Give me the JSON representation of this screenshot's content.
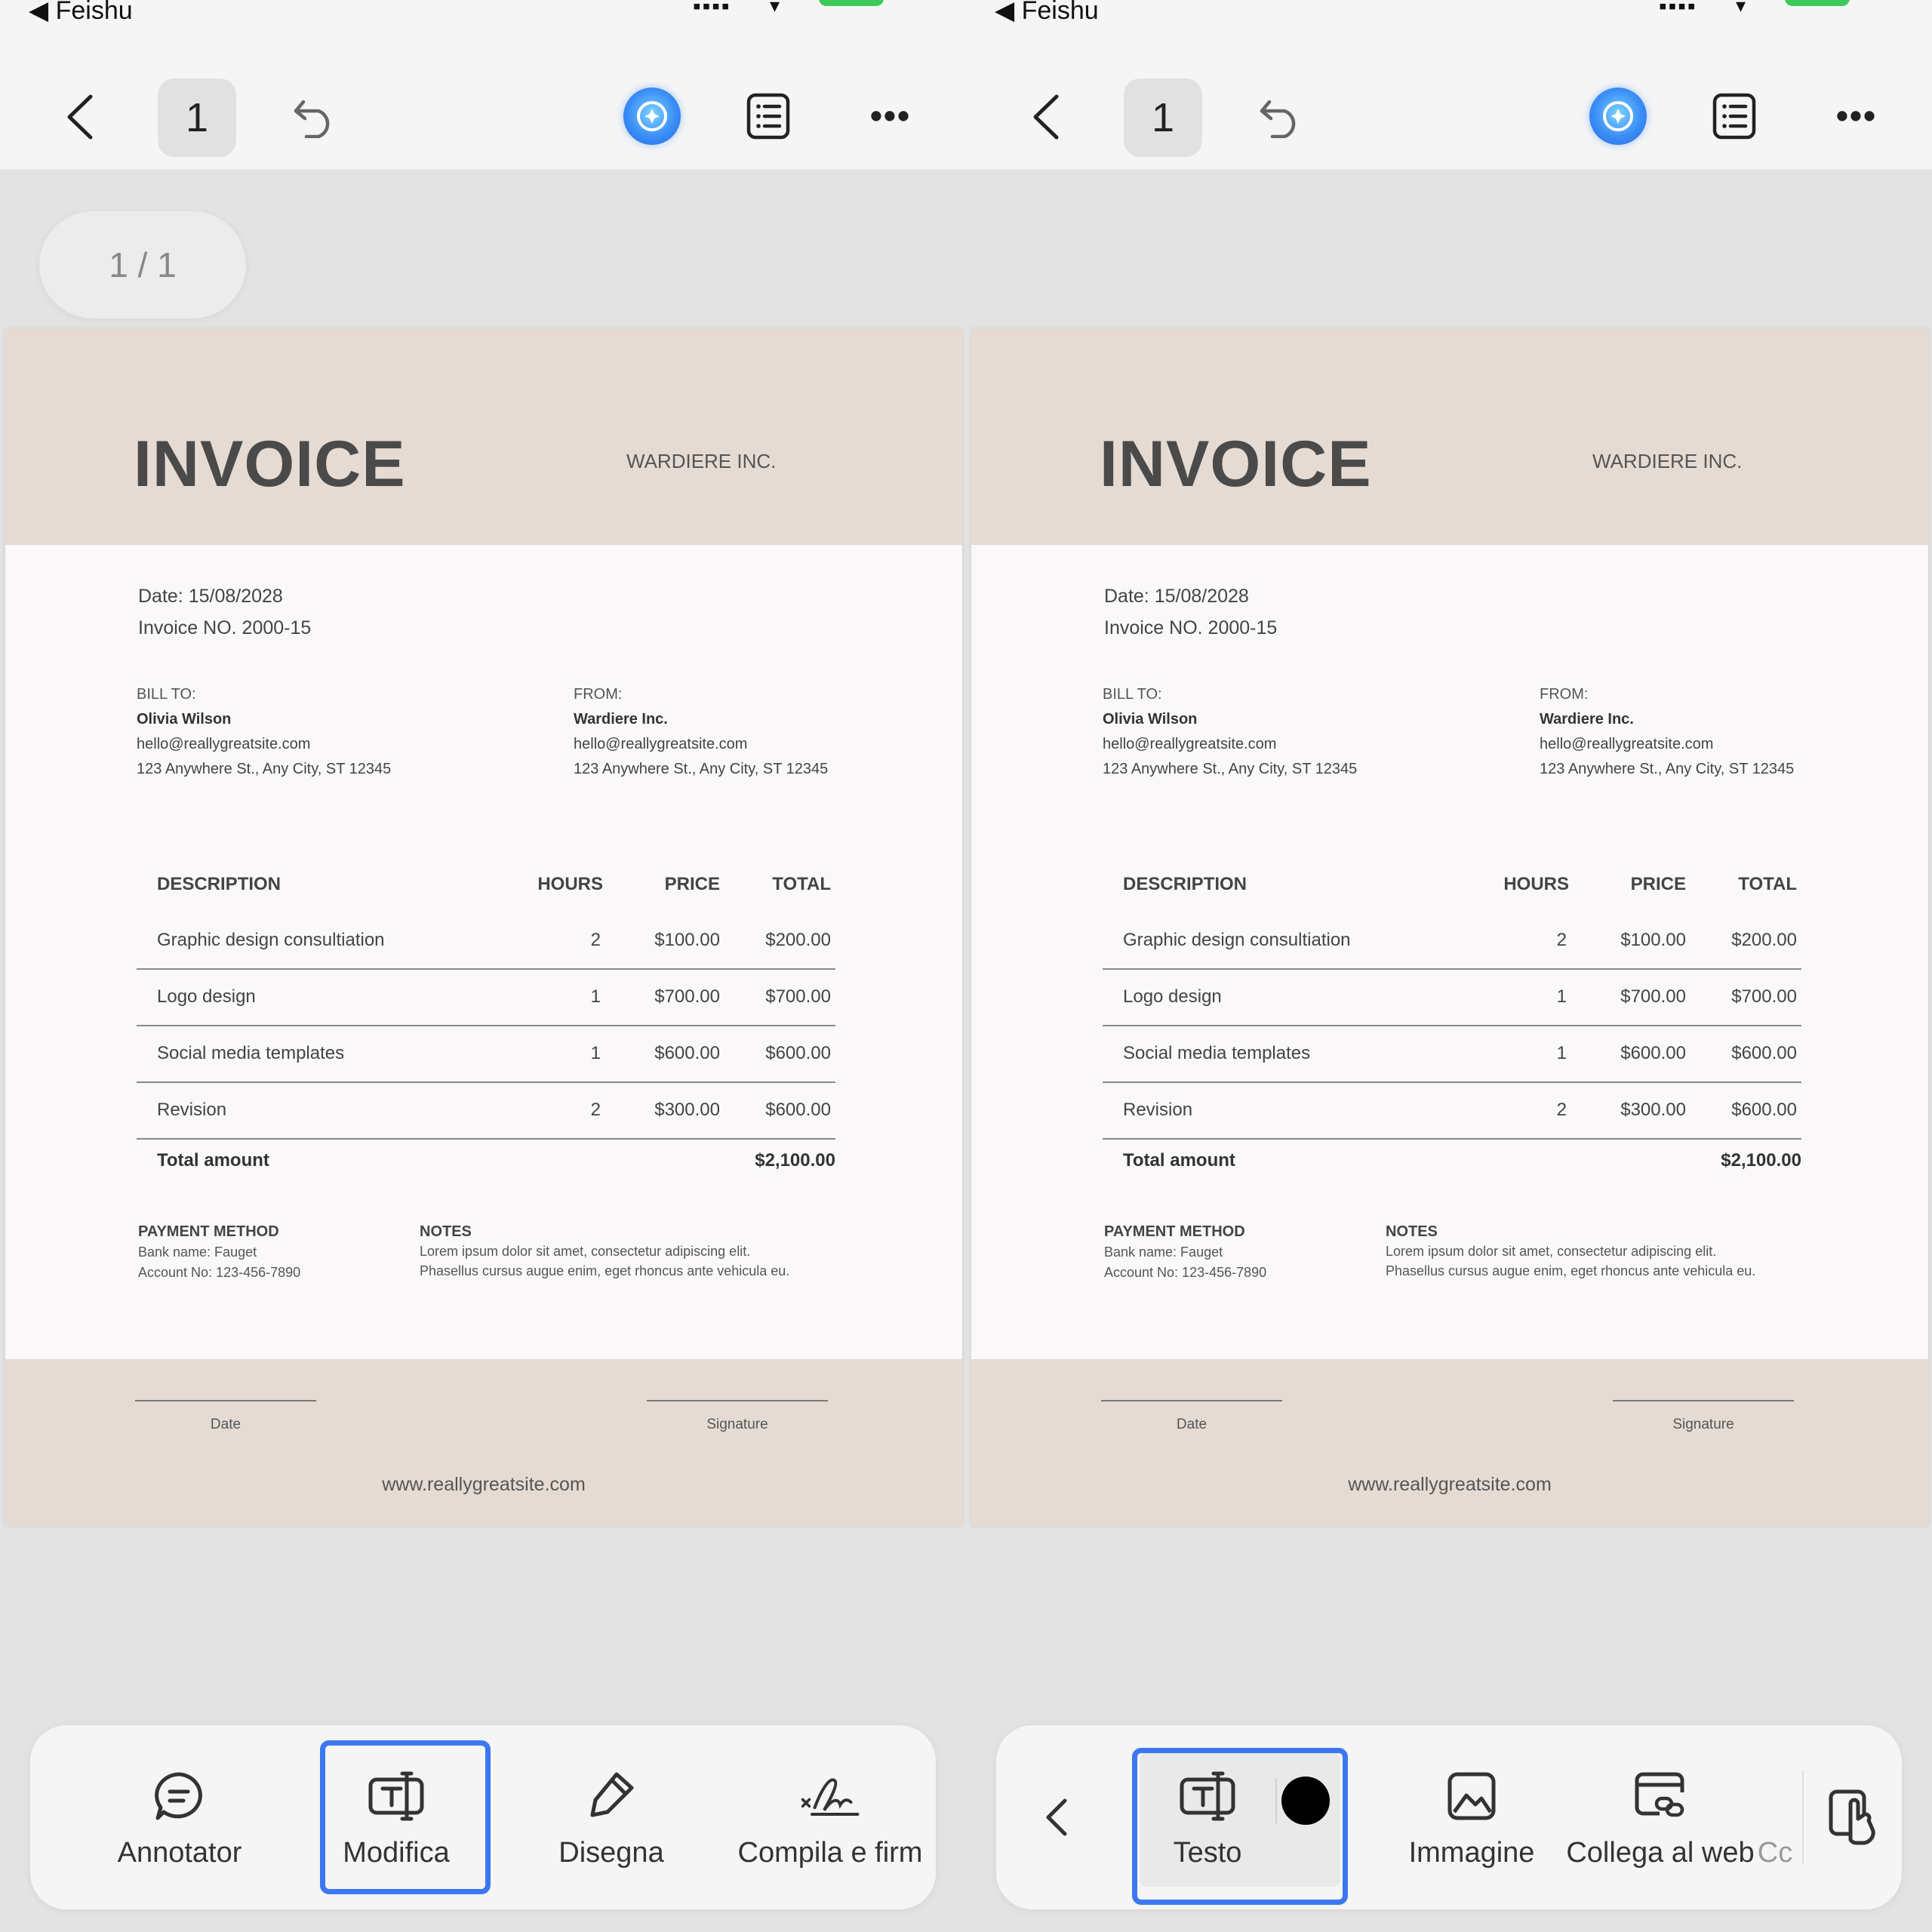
{
  "status_bar": {
    "back_app": "◀ Feishu"
  },
  "toolbar": {
    "page_number": "1"
  },
  "page_indicator": "1 / 1",
  "invoice": {
    "title": "INVOICE",
    "company": "WARDIERE INC.",
    "date": "Date: 15/08/2028",
    "invoice_no": "Invoice NO. 2000-15",
    "bill_to": {
      "label": "BILL TO:",
      "name": "Olivia  Wilson",
      "email": "hello@reallygreatsite.com",
      "address": "123 Anywhere St., Any City, ST 12345"
    },
    "from": {
      "label": "FROM:",
      "name": "Wardiere Inc.",
      "email": "hello@reallygreatsite.com",
      "address": "123 Anywhere St., Any City, ST 12345"
    },
    "table": {
      "headers": {
        "description": "DESCRIPTION",
        "hours": "HOURS",
        "price": "PRICE",
        "total": "TOTAL"
      },
      "rows": [
        {
          "description": "Graphic design consultiation",
          "hours": "2",
          "price": "$100.00",
          "total": "$200.00"
        },
        {
          "description": "Logo design",
          "hours": "1",
          "price": "$700.00",
          "total": "$700.00"
        },
        {
          "description": "Social media templates",
          "hours": "1",
          "price": "$600.00",
          "total": "$600.00"
        },
        {
          "description": "Revision",
          "hours": "2",
          "price": "$300.00",
          "total": "$600.00"
        }
      ],
      "total_label": "Total amount",
      "total_value": "$2,100.00"
    },
    "payment": {
      "heading": "PAYMENT METHOD",
      "bank": "Bank name: Fauget",
      "account": "Account No: 123-456-7890"
    },
    "notes": {
      "heading": "NOTES",
      "line1": "Lorem ipsum dolor sit amet, consectetur adipiscing elit.",
      "line2": "Phasellus cursus augue enim, eget rhoncus ante vehicula eu."
    },
    "footer": {
      "date_label": "Date",
      "signature_label": "Signature",
      "website": "www.reallygreatsite.com"
    }
  },
  "left_tools": [
    {
      "label": "Annotator"
    },
    {
      "label": "Modifica"
    },
    {
      "label": "Disegna"
    },
    {
      "label": "Compila e firm"
    }
  ],
  "right_tools": [
    {
      "label": "Testo"
    },
    {
      "label": "Immagine"
    },
    {
      "label": "Collega al web"
    },
    {
      "label": "Cc"
    }
  ],
  "colors": {
    "accent": "#3b78f0",
    "doc_band": "#e5dbd3",
    "battery": "#3cc95a"
  }
}
